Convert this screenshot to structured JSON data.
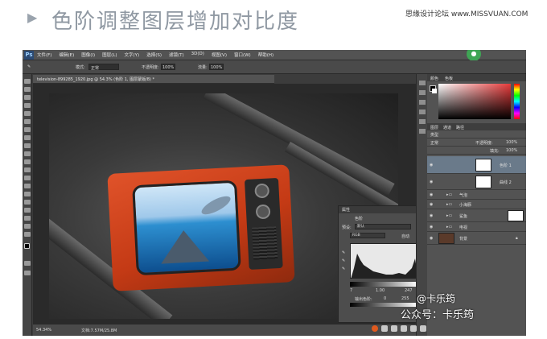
{
  "header": {
    "arrow": "▶",
    "title": "色阶调整图层增加对比度",
    "site": "思缘设计论坛 www.MISSVUAN.COM"
  },
  "app": {
    "logo": "Ps",
    "menus": [
      "文件(F)",
      "编辑(E)",
      "图像(I)",
      "图层(L)",
      "文字(Y)",
      "选择(S)",
      "滤镜(T)",
      "3D(D)",
      "视图(V)",
      "窗口(W)",
      "帮助(H)"
    ],
    "options": {
      "mode_label": "模式:",
      "mode_value": "正常",
      "opacity_label": "不透明度:",
      "opacity_value": "100%",
      "flow_label": "流量:",
      "flow_value": "100%"
    },
    "document_tab": "television-899285_1920.jpg @ 54.3% (色阶 1, 图层蒙版/8) *",
    "status": {
      "zoom": "54.34%",
      "doc": "文档:7.57M/25.8M"
    }
  },
  "properties_panel": {
    "tab": "属性",
    "title": "色阶",
    "preset_label": "预设:",
    "preset_value": "默认",
    "channel_value": "RGB",
    "auto_label": "自动",
    "input_levels": [
      "7",
      "1.00",
      "247"
    ],
    "output_label": "输出色阶:",
    "output_levels": [
      "0",
      "255"
    ]
  },
  "right_panels": {
    "color_tabs": [
      "颜色",
      "色板"
    ],
    "layer_tabs": [
      "图层",
      "通道",
      "路径"
    ],
    "blend_mode": "正常",
    "opacity_label": "不透明度:",
    "opacity_value": "100%",
    "fill_label": "填充:",
    "fill_value": "100%",
    "kind_label": "类型",
    "layers": [
      {
        "name": "色阶 1",
        "selected": true
      },
      {
        "name": "曲线 2",
        "selected": false
      },
      {
        "name": "气泡",
        "selected": false
      },
      {
        "name": "小海豚",
        "selected": false
      },
      {
        "name": "鲨鱼",
        "selected": false
      },
      {
        "name": "电视",
        "selected": false
      },
      {
        "name": "背景",
        "selected": false
      }
    ]
  },
  "watermark": {
    "line1": "@卡乐筠",
    "line2": "公众号：卡乐筠"
  },
  "colors": {
    "accent_orange": "#e0532a",
    "ps_bg": "#3c3c3c",
    "panel_bg": "#535353"
  }
}
